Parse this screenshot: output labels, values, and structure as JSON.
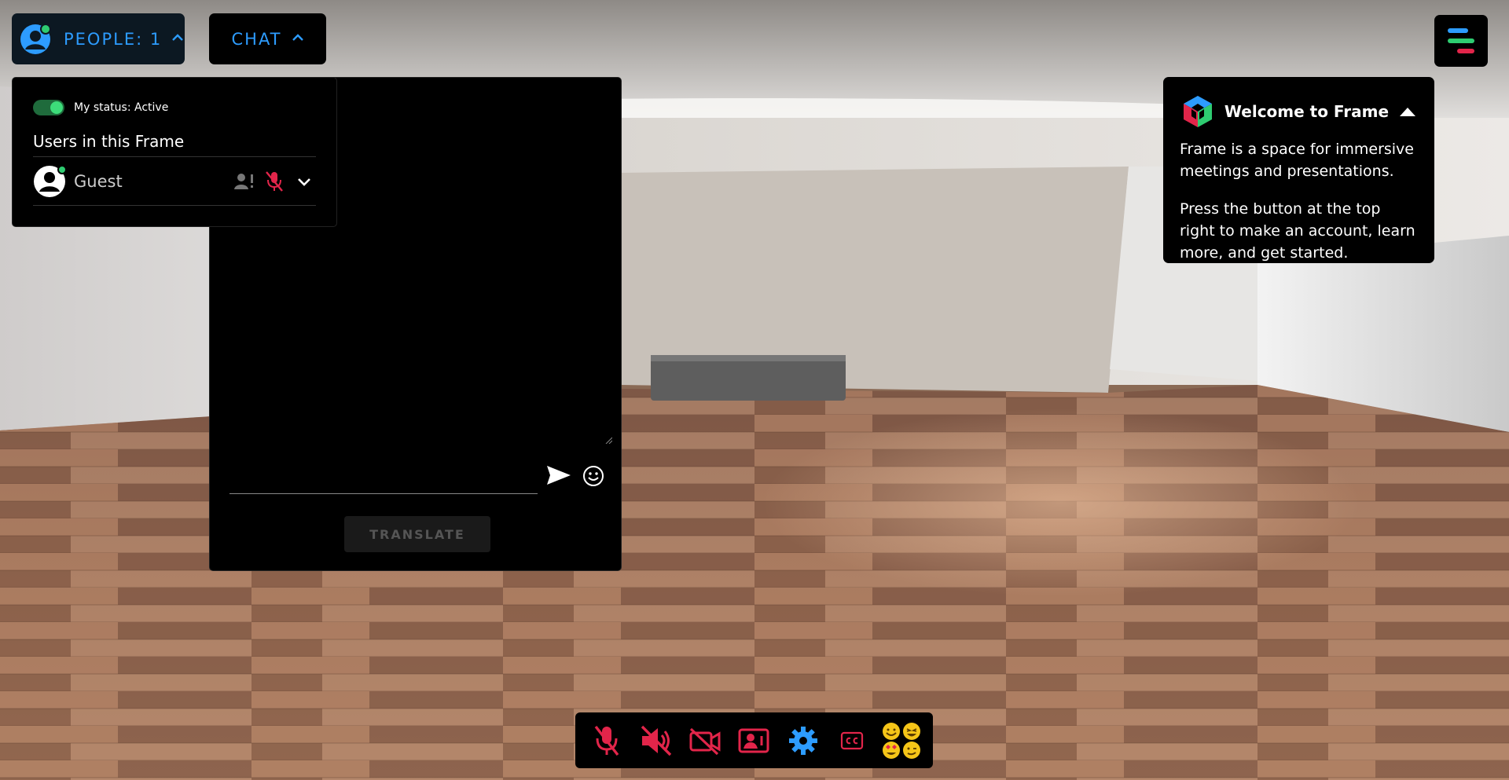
{
  "top": {
    "people_label": "PEOPLE: 1",
    "chat_label": "CHAT"
  },
  "people_panel": {
    "status_label": "My status: Active",
    "users_title": "Users in this Frame",
    "users": [
      {
        "name": "Guest"
      }
    ]
  },
  "chat": {
    "input_value": "",
    "translate_label": "TRANSLATE"
  },
  "welcome": {
    "title": "Welcome to Frame",
    "paragraphs": [
      "Frame is a space for immersive meetings and presentations.",
      "Press the button at the top right to make an account, learn more, and get started."
    ]
  },
  "toolbar": {
    "buttons": [
      {
        "name": "mic-muted-icon"
      },
      {
        "name": "speaker-muted-icon"
      },
      {
        "name": "camera-off-icon"
      },
      {
        "name": "screenshare-icon"
      },
      {
        "name": "settings-gear-icon"
      },
      {
        "name": "closed-captions-icon"
      },
      {
        "name": "emoji-reactions-icon"
      }
    ]
  },
  "colors": {
    "accent_blue": "#2d9cff",
    "danger_red": "#e2254a",
    "status_green": "#2ecc71",
    "panel_bg": "#000000"
  }
}
